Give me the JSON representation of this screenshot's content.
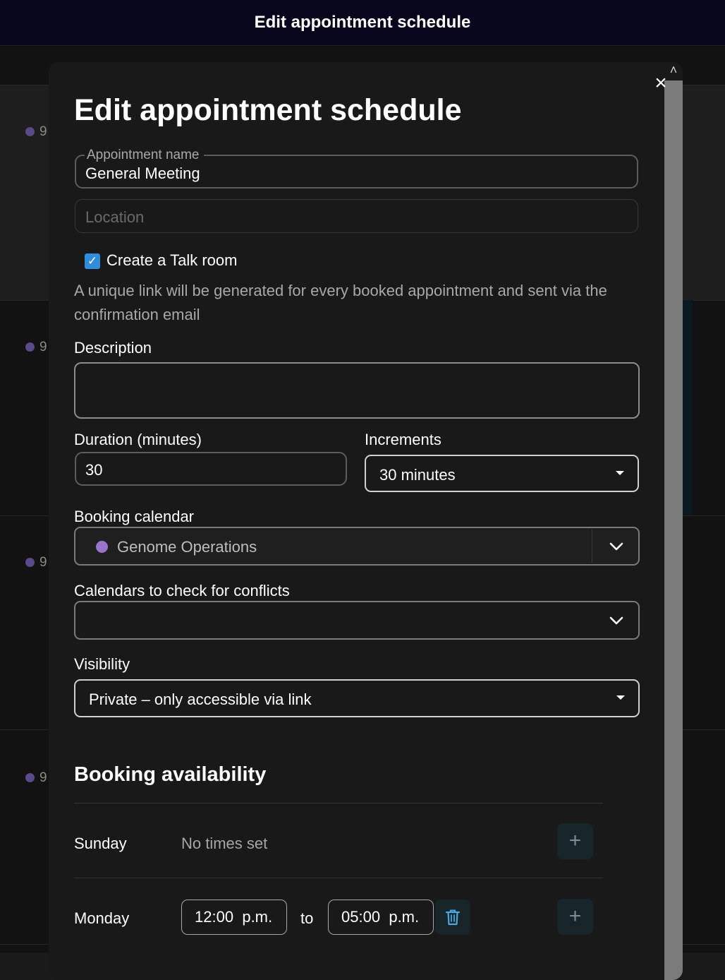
{
  "window": {
    "title": "Edit appointment schedule"
  },
  "background": {
    "day_numbers": [
      "9",
      "9",
      "9",
      "9"
    ]
  },
  "modal": {
    "title": "Edit appointment schedule",
    "close_label": "×",
    "appointment_name": {
      "label": "Appointment name",
      "value": "General Meeting"
    },
    "location": {
      "placeholder": "Location",
      "value": ""
    },
    "talk_room": {
      "checked": true,
      "label": "Create a Talk room",
      "hint": "A unique link will be generated for every booked appointment and sent via the confirmation email"
    },
    "description": {
      "label": "Description",
      "value": ""
    },
    "duration": {
      "label": "Duration (minutes)",
      "value": "30"
    },
    "increments": {
      "label": "Increments",
      "value": "30 minutes"
    },
    "booking_calendar": {
      "label": "Booking calendar",
      "value": "Genome Operations",
      "color": "#9b74c9"
    },
    "conflict_calendars": {
      "label": "Calendars to check for conflicts",
      "value": ""
    },
    "visibility": {
      "label": "Visibility",
      "value": "Private – only accessible via link"
    },
    "availability": {
      "title": "Booking availability",
      "days": [
        {
          "name": "Sunday",
          "status": "No times set"
        },
        {
          "name": "Monday",
          "start_h": "12",
          "start_m": "00",
          "start_ampm": "p.m.",
          "separator": "to",
          "end_h": "05",
          "end_m": "00",
          "end_ampm": "p.m."
        }
      ]
    }
  }
}
